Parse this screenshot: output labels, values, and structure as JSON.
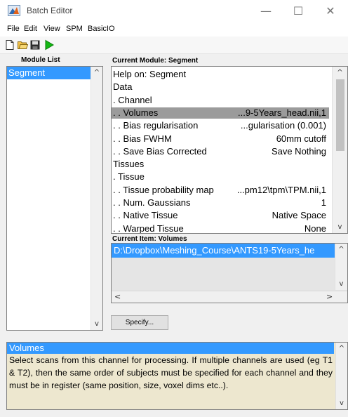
{
  "window": {
    "title": "Batch Editor",
    "minimize": "—",
    "maximize": "☐",
    "close": "✕"
  },
  "menu": [
    "File",
    "Edit",
    "View",
    "SPM",
    "BasicIO"
  ],
  "toolbar": {
    "icons": [
      "new-file-icon",
      "open-folder-icon",
      "save-icon",
      "run-icon"
    ]
  },
  "module_list": {
    "label": "Module List",
    "items": [
      "Segment"
    ]
  },
  "current_module": {
    "label": "Current Module: Segment",
    "rows": [
      {
        "label": "Help on: Segment",
        "value": ""
      },
      {
        "label": "Data",
        "value": ""
      },
      {
        "label": ". Channel",
        "value": ""
      },
      {
        "label": ". . Volumes",
        "value": "...9-5Years_head.nii,1"
      },
      {
        "label": ". . Bias regularisation",
        "value": "...gularisation (0.001)"
      },
      {
        "label": ". . Bias FWHM",
        "value": "60mm cutoff"
      },
      {
        "label": ". . Save Bias Corrected",
        "value": "Save Nothing"
      },
      {
        "label": "Tissues",
        "value": ""
      },
      {
        "label": ". Tissue",
        "value": ""
      },
      {
        "label": ". . Tissue probability map",
        "value": "...pm12\\tpm\\TPM.nii,1"
      },
      {
        "label": ". . Num. Gaussians",
        "value": "1"
      },
      {
        "label": ". . Native Tissue",
        "value": "Native Space"
      },
      {
        "label": ". . Warped Tissue",
        "value": "None"
      }
    ]
  },
  "current_item": {
    "label": "Current Item: Volumes",
    "value": "D:\\Dropbox\\Meshing_Course\\ANTS19-5Years_he"
  },
  "specify_button": "Specify...",
  "help": {
    "title": "Volumes",
    "text": "Select scans from this channel for processing. If multiple channels are used (eg T1 & T2), then the same order of subjects must be specified for each channel and they must be in register (same position, size, voxel dims etc..)."
  },
  "colors": {
    "selection": "#3399ff",
    "selected_row": "#9b9b9b",
    "help_bg": "#ede7cf"
  }
}
